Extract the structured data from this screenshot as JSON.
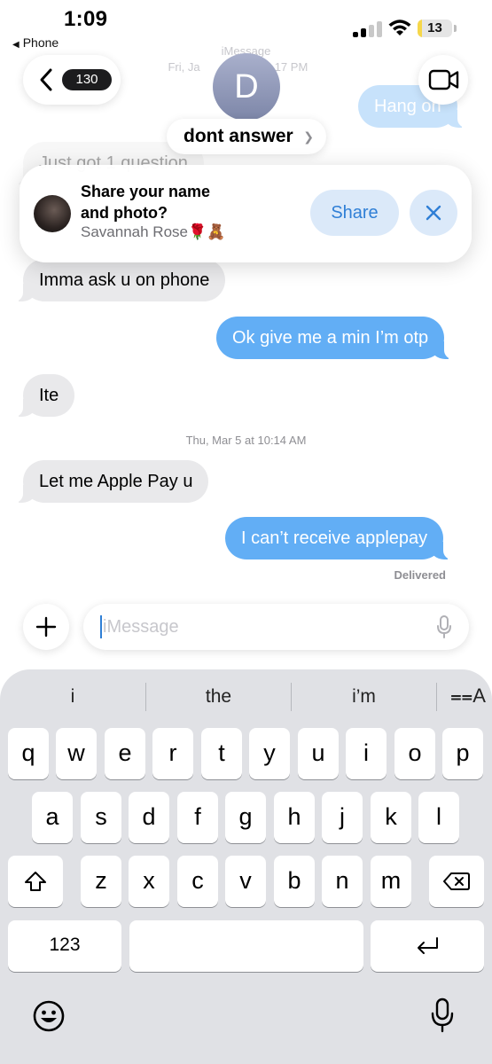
{
  "status_bar": {
    "time": "1:09",
    "back_app": "Phone",
    "battery": "13",
    "battery_level": 0.13,
    "colors": {
      "battery_fill": "#f6d74a"
    }
  },
  "header": {
    "faded_service": "iMessage",
    "faded_date": "Fri, Ja",
    "faded_time": "17 PM",
    "back_count": "130",
    "avatar_letter": "D",
    "contact_name": "dont answer",
    "icons": {
      "back": "chevron-left-icon",
      "video": "video-camera-icon"
    }
  },
  "share_banner": {
    "title": "Share your name and photo?",
    "subtitle": "Savannah Rose🌹🧸",
    "share_label": "Share",
    "icons": {
      "close": "close-icon"
    }
  },
  "messages": [
    {
      "side": "out",
      "text": "Hang on",
      "faded": true
    },
    {
      "side": "in",
      "text": "Just got 1 question",
      "faded": true
    },
    {
      "side": "in",
      "text": "Imma ask u on phone"
    },
    {
      "side": "out",
      "text": "Ok give me a min I’m otp"
    },
    {
      "side": "in",
      "text": "Ite"
    },
    {
      "side": "in",
      "text": "Let me Apple Pay u"
    },
    {
      "side": "out",
      "text": "I can’t receive applepay"
    }
  ],
  "timestamp": "Thu, Mar 5 at 10:14 AM",
  "delivered": "Delivered",
  "input": {
    "placeholder": "iMessage",
    "icons": {
      "add": "plus-icon",
      "dictate": "microphone-icon"
    }
  },
  "keyboard": {
    "suggestions": [
      "i",
      "the",
      "i’m"
    ],
    "format_label": "⩵A",
    "row1": [
      "q",
      "w",
      "e",
      "r",
      "t",
      "y",
      "u",
      "i",
      "o",
      "p"
    ],
    "row2": [
      "a",
      "s",
      "d",
      "f",
      "g",
      "h",
      "j",
      "k",
      "l"
    ],
    "row3": [
      "z",
      "x",
      "c",
      "v",
      "b",
      "n",
      "m"
    ],
    "numbers_label": "123",
    "icons": {
      "shift": "shift-icon",
      "delete": "delete-icon",
      "return": "return-icon",
      "emoji": "emoji-icon",
      "dictation": "microphone-icon"
    }
  },
  "colors": {
    "outgoing_bubble": "#62aef5",
    "incoming_bubble": "#e9e9eb",
    "accent": "#2f7fd6",
    "keyboard_bg": "#e0e1e5"
  }
}
